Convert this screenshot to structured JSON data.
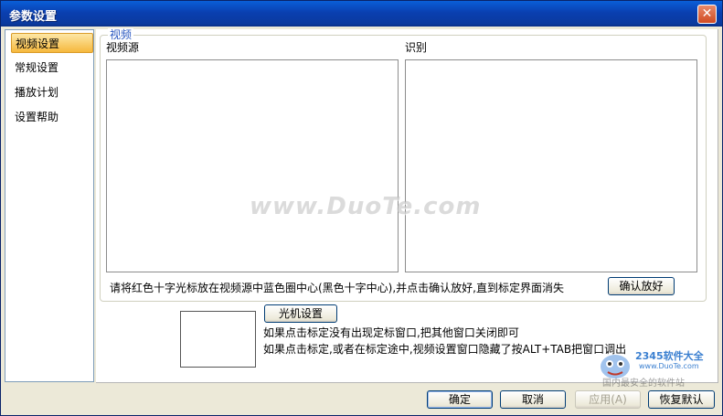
{
  "window": {
    "title": "参数设置",
    "close_glyph": "✕"
  },
  "sidebar": {
    "items": [
      {
        "label": "视频设置",
        "active": true
      },
      {
        "label": "常规设置",
        "active": false
      },
      {
        "label": "播放计划",
        "active": false
      },
      {
        "label": "设置帮助",
        "active": false
      }
    ]
  },
  "video_group": {
    "legend": "视频",
    "source_label": "视频源",
    "recognize_label": "识别",
    "instruction": "请将红色十字光标放在视频源中蓝色圈中心(黑色十字中心),并点击确认放好,直到标定界面消失",
    "confirm_button": "确认放好"
  },
  "camera": {
    "button": "光机设置",
    "hint1": "如果点击标定没有出现定标窗口,把其他窗口关闭即可",
    "hint2": "如果点击标定,或者在标定途中,视频设置窗口隐藏了按ALT+TAB把窗口调出"
  },
  "footer": {
    "ok": "确定",
    "cancel": "取消",
    "apply": "应用(A)",
    "restore": "恢复默认"
  },
  "watermark": {
    "text": "www.DuoTe.com",
    "brand": "2345软件大全",
    "brand_url": "www.DuoTe.com",
    "brand_tagline": "国内最安全的软件站"
  }
}
